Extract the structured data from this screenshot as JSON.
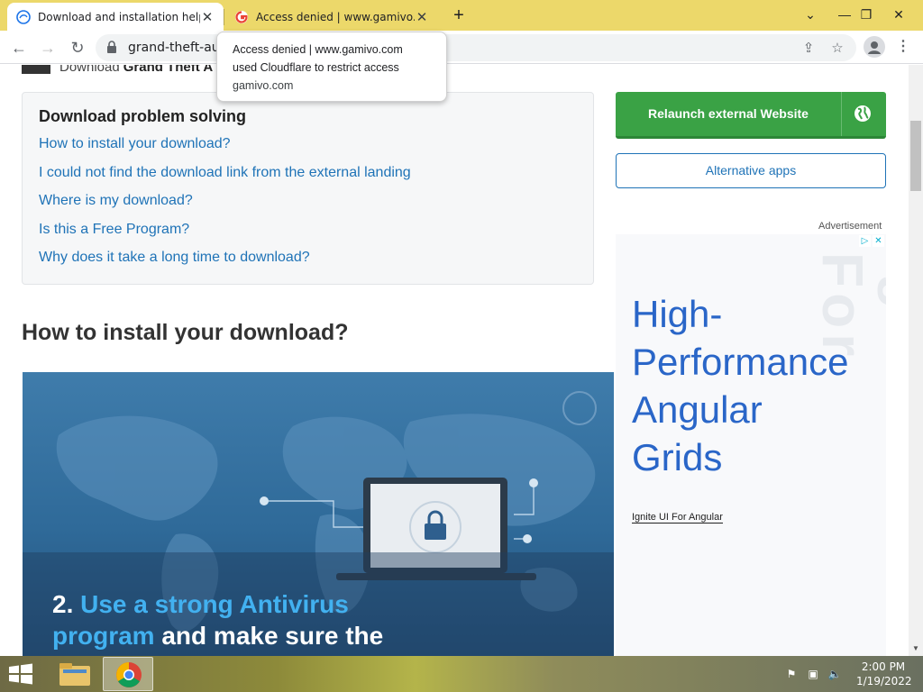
{
  "tabs": [
    {
      "title": "Download and installation help",
      "active": true,
      "icon": "softonic-icon"
    },
    {
      "title": "Access denied | www.gamivo.con",
      "active": false,
      "icon": "google-icon"
    }
  ],
  "toolbar": {
    "url": "grand-theft-aut"
  },
  "tooltip": {
    "line1": "Access denied | www.gamivo.com",
    "line2": "used Cloudflare to restrict access",
    "domain": "gamivo.com"
  },
  "page": {
    "crumb_prefix": "Download",
    "crumb_bold": "Grand Theft A",
    "problem_title": "Download problem solving",
    "problem_links": [
      "How to install your download?",
      "I could not find the download link from the external landing",
      "Where is my download?",
      "Is this a Free Program?",
      "Why does it take a long time to download?"
    ],
    "how_title": "How to install your download?",
    "hero_caption": {
      "num": "2.",
      "highlight1": "Use a strong Antivirus",
      "highlight2": "program",
      "rest": "and make sure the"
    },
    "relaunch_label": "Relaunch external Website",
    "alt_apps_label": "Alternative apps",
    "ad_label": "Advertisement",
    "ad": {
      "headline_1": "High-",
      "headline_2": "Performance",
      "headline_3": "Angular",
      "headline_4": "Grids",
      "link": "Ignite UI For Angular",
      "bg_text": "Ignite UI For"
    }
  },
  "taskbar": {
    "time": "2:00 PM",
    "date": "1/19/2022"
  },
  "colors": {
    "tabstrip": "#ecd86a",
    "link": "#1f73b7",
    "relaunch_green": "#3aa245",
    "ad_blue": "#2a66c8"
  }
}
